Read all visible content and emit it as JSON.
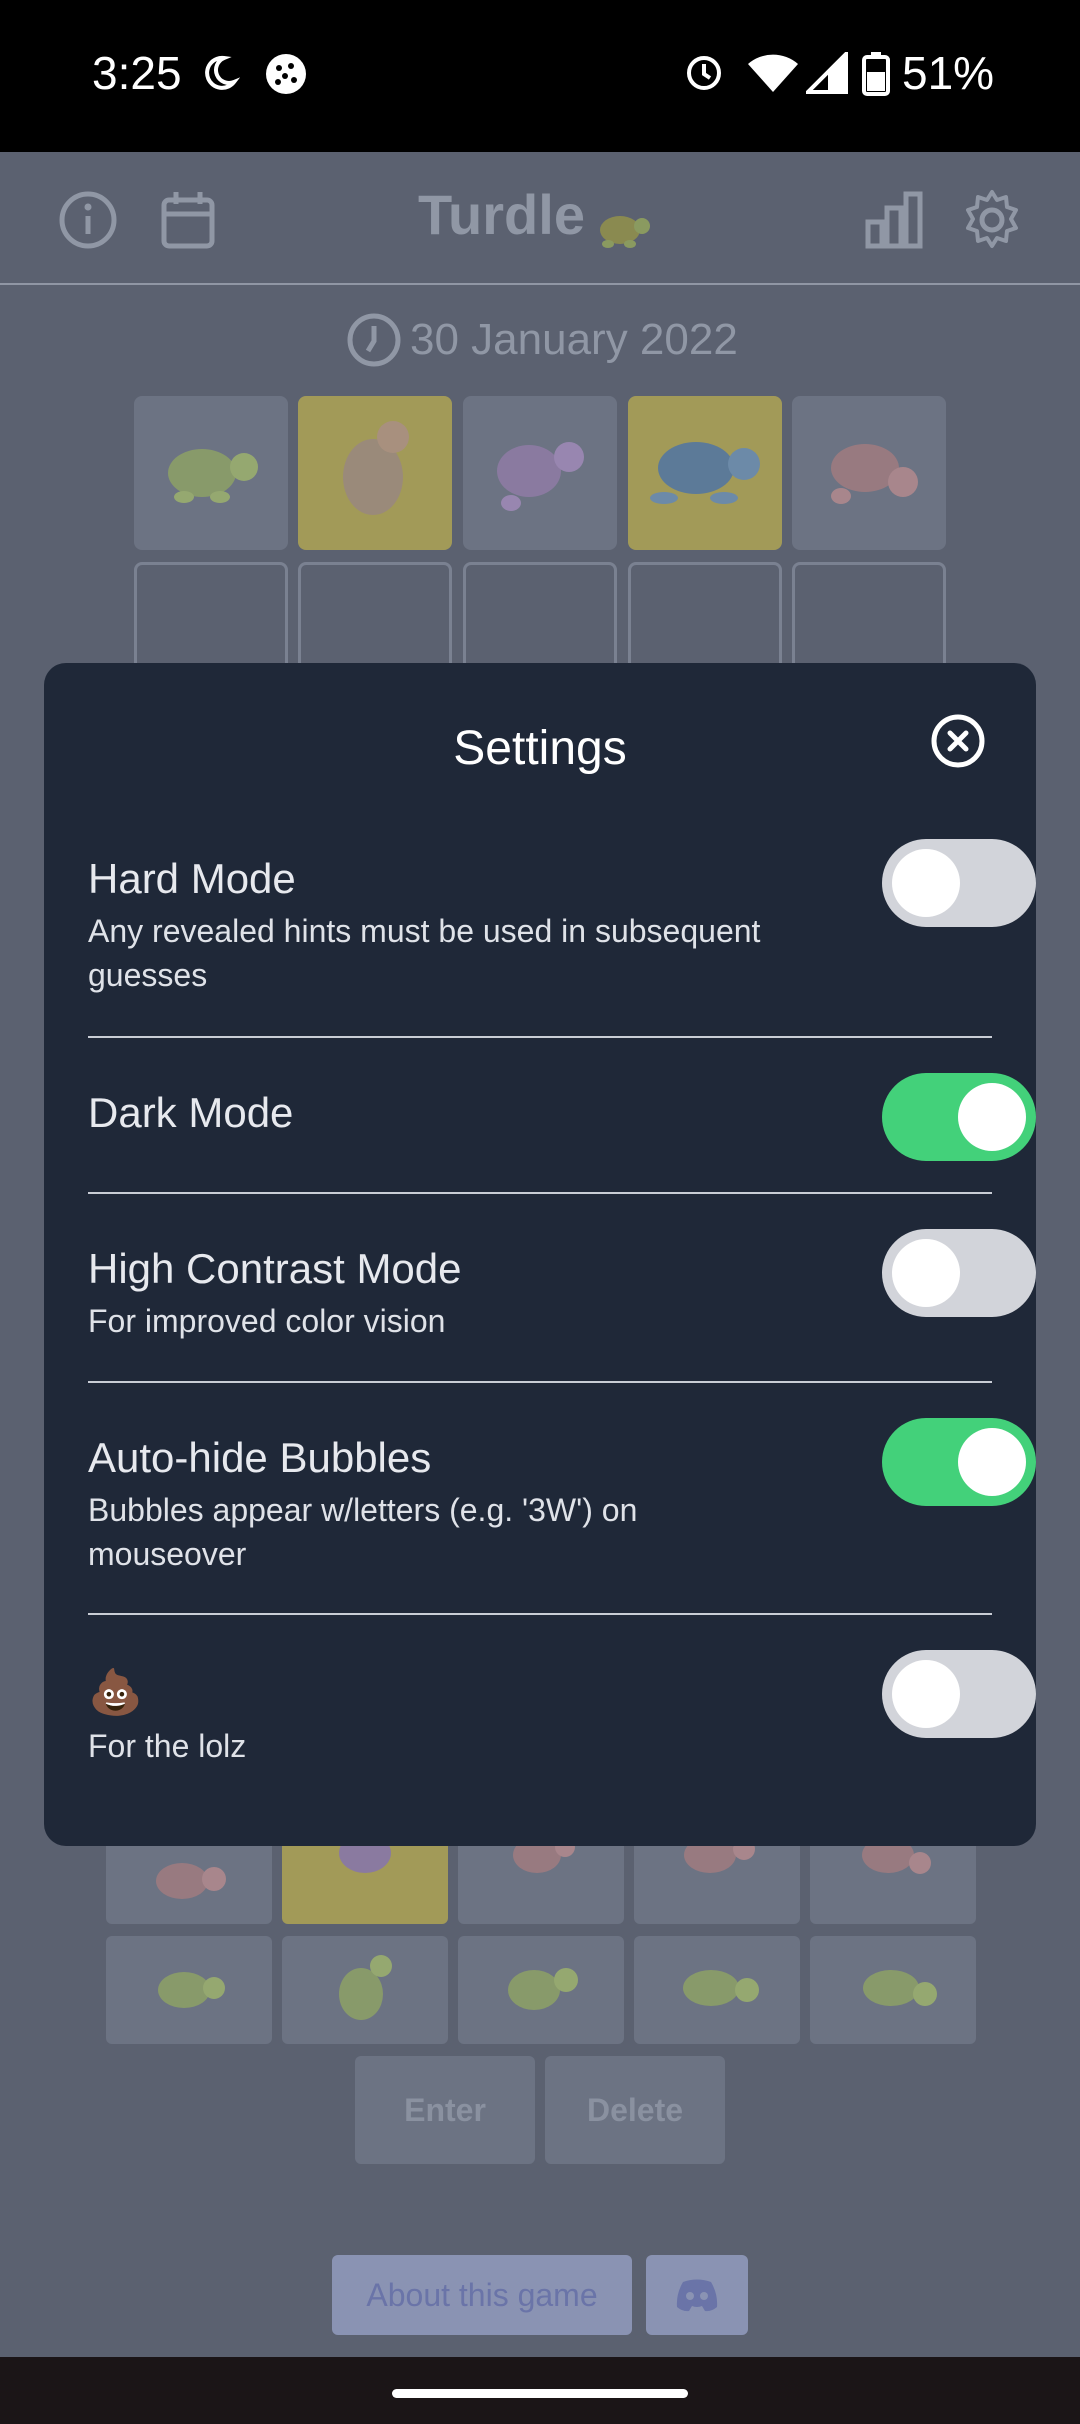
{
  "status_bar": {
    "time": "3:25",
    "battery": "51%"
  },
  "header": {
    "title": "Turdle",
    "date": "30 January 2022"
  },
  "modal": {
    "title": "Settings",
    "settings": [
      {
        "title": "Hard Mode",
        "description": "Any revealed hints must be used in subsequent guesses",
        "enabled": false
      },
      {
        "title": "Dark Mode",
        "description": "",
        "enabled": true
      },
      {
        "title": "High Contrast Mode",
        "description": "For improved color vision",
        "enabled": false
      },
      {
        "title": "Auto-hide Bubbles",
        "description": "Bubbles appear w/letters (e.g. '3W') on mouseover",
        "enabled": true
      },
      {
        "title": "💩",
        "description": "For the lolz",
        "enabled": false
      }
    ]
  },
  "grid": {
    "row1": [
      {
        "color": "green",
        "state": "absent"
      },
      {
        "color": "pink",
        "state": "present"
      },
      {
        "color": "purple",
        "state": "absent"
      },
      {
        "color": "blue",
        "state": "present"
      },
      {
        "color": "pink",
        "state": "absent"
      }
    ]
  },
  "keyboard": {
    "row_top": [
      "pink",
      "purple",
      "pink",
      "pink",
      "pink"
    ],
    "row_bottom": [
      "green",
      "green",
      "green",
      "green",
      "green"
    ],
    "enter_label": "Enter",
    "delete_label": "Delete"
  },
  "footer": {
    "about_label": "About this game"
  },
  "colors": {
    "toggle_on": "#43d17a",
    "modal_bg": "#1f2838",
    "present_tile": "#a29a58"
  }
}
